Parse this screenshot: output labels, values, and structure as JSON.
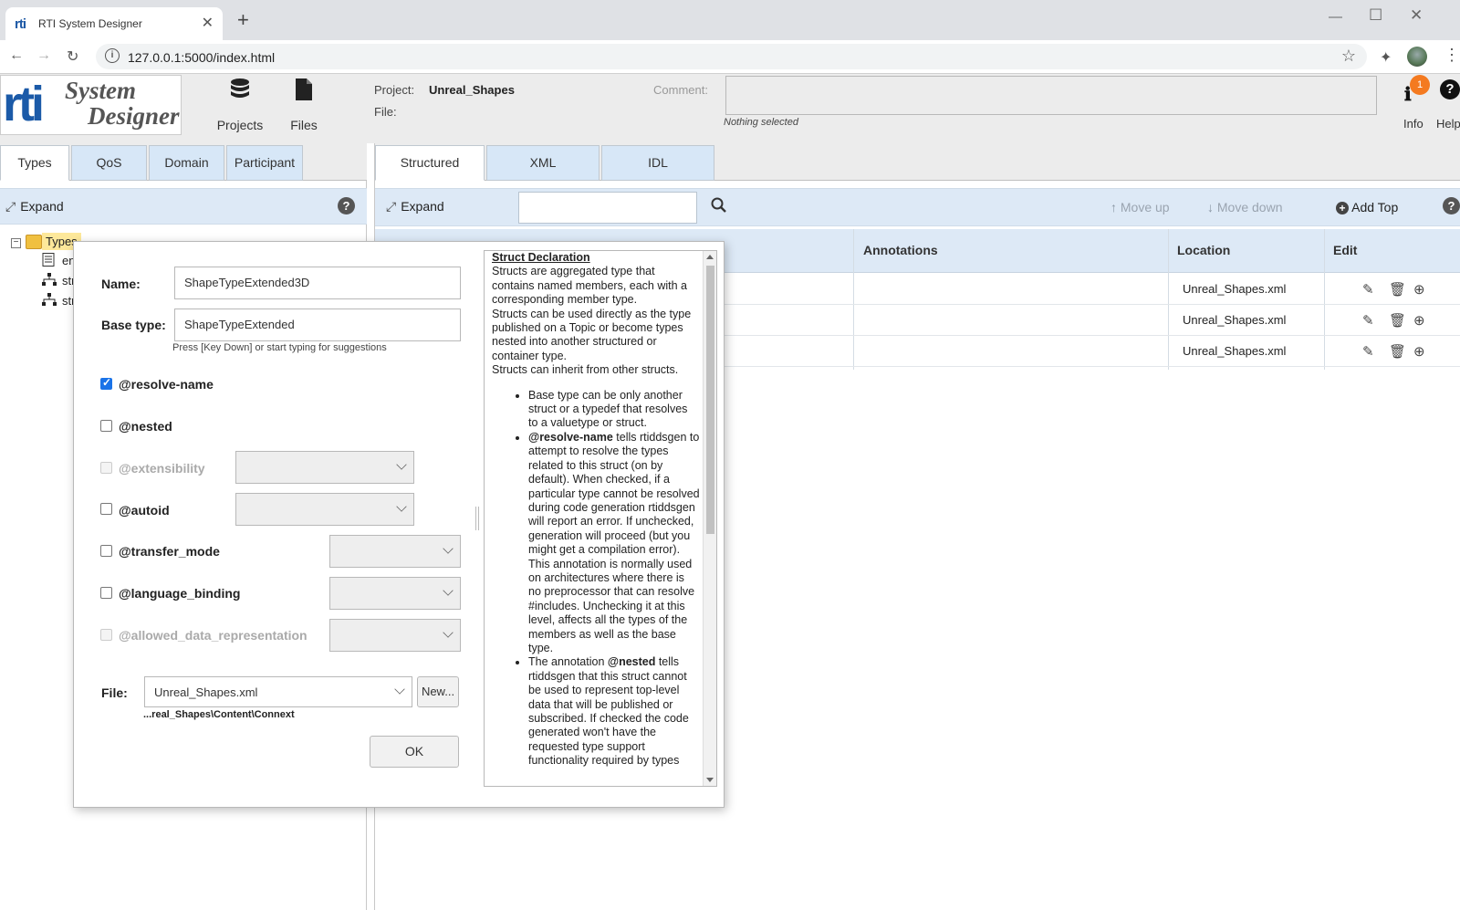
{
  "browser": {
    "tab_title": "RTI System Designer",
    "tab_favicon": "rti",
    "url": "127.0.0.1:5000/index.html"
  },
  "header": {
    "logo": {
      "mark": "rti",
      "line1": "System",
      "line2": "Designer"
    },
    "projects_label": "Projects",
    "files_label": "Files",
    "project_label": "Project:",
    "project_value": "Unreal_Shapes",
    "file_label": "File:",
    "comment_label": "Comment:",
    "nothing_selected": "Nothing selected",
    "info_label": "Info",
    "info_badge": "1",
    "help_label": "Help"
  },
  "left": {
    "tabs": [
      "Types",
      "QoS",
      "Domain",
      "Participant"
    ],
    "active_tab": "Types",
    "expand_label": "Expand",
    "tree": {
      "root": "Types",
      "children": [
        "en",
        "str",
        "str"
      ]
    }
  },
  "right": {
    "tabs": [
      "Structured",
      "XML",
      "IDL"
    ],
    "active_tab": "Structured",
    "expand_label": "Expand",
    "search_value": "",
    "move_up": "Move up",
    "move_down": "Move down",
    "add_top": "Add Top",
    "columns": [
      "Annotations",
      "Location",
      "Edit"
    ],
    "rows": [
      {
        "location": "Unreal_Shapes.xml"
      },
      {
        "location": "Unreal_Shapes.xml"
      },
      {
        "location": "Unreal_Shapes.xml"
      }
    ]
  },
  "dialog": {
    "name_label": "Name:",
    "name_value": "ShapeTypeExtended3D",
    "base_type_label": "Base type:",
    "base_type_value": "ShapeTypeExtended",
    "hint": "Press [Key Down] or start typing for suggestions",
    "annotations": [
      {
        "label": "@resolve-name",
        "checked": true,
        "disabled": false
      },
      {
        "label": "@nested",
        "checked": false,
        "disabled": false
      },
      {
        "label": "@extensibility",
        "checked": false,
        "disabled": true
      },
      {
        "label": "@autoid",
        "checked": false,
        "disabled": false
      },
      {
        "label": "@transfer_mode",
        "checked": false,
        "disabled": false
      },
      {
        "label": "@language_binding",
        "checked": false,
        "disabled": false
      },
      {
        "label": "@allowed_data_representation",
        "checked": false,
        "disabled": true
      }
    ],
    "file_label": "File:",
    "file_value": "Unreal_Shapes.xml",
    "new_button": "New...",
    "file_path": "...real_Shapes\\Content\\Connext",
    "ok_button": "OK",
    "help": {
      "title": "Struct Declaration",
      "intro1": "Structs are aggregated type that contains named members, each with a corresponding member type.",
      "intro2": "Structs can be used directly as the type published on a Topic or become types nested into another structured or container type.",
      "intro3": "Structs can inherit from other structs.",
      "bullet1": "Base type can be only another struct or a typedef that resolves to a valuetype or struct.",
      "bullet2_bold": "@resolve-name",
      "bullet2_text": " tells rtiddsgen to attempt to resolve the types related to this struct (on by default). When checked, if a particular type cannot be resolved during code generation rtiddsgen will report an error. If unchecked, generation will proceed (but you might get a compilation error). This annotation is normally used on architectures where there is no preprocessor that can resolve #includes. Unchecking it at this level, affects all the types of the members as well as the base type.",
      "bullet3_pre": "The annotation ",
      "bullet3_bold": "@nested",
      "bullet3_text": " tells rtiddsgen that this struct cannot be used to represent top-level data that will be published or subscribed. If checked the code generated won't have the requested type support functionality required by types"
    }
  }
}
